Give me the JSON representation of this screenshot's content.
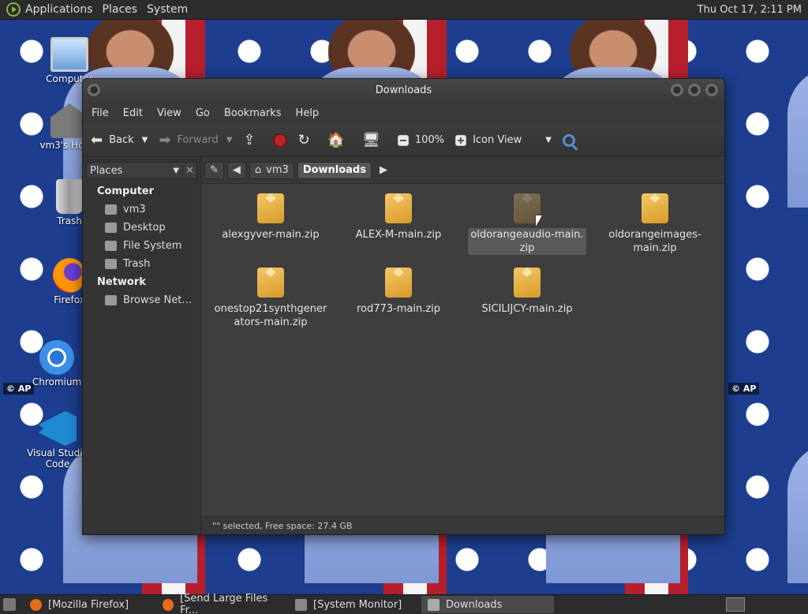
{
  "top_panel": {
    "menus": [
      "Applications",
      "Places",
      "System"
    ],
    "clock": "Thu Oct 17,  2:11 PM"
  },
  "desktop": {
    "icons": [
      {
        "label": "Computer",
        "icon": "computer-icon"
      },
      {
        "label": "vm3's Home",
        "icon": "home-icon"
      },
      {
        "label": "Trash",
        "icon": "trash-icon"
      },
      {
        "label": "Firefox",
        "icon": "firefox-icon"
      },
      {
        "label": "Chromium",
        "icon": "chromium-icon"
      },
      {
        "label": "Visual Studio Code",
        "icon": "vscode-icon"
      }
    ],
    "badge": "© AP"
  },
  "window": {
    "title": "Downloads",
    "menu": [
      "File",
      "Edit",
      "View",
      "Go",
      "Bookmarks",
      "Help"
    ],
    "toolbar": {
      "back": "Back",
      "forward": "Forward",
      "zoom": "100%",
      "view_mode": "Icon View"
    },
    "sidebar": {
      "header": "Places",
      "sections": [
        {
          "title": "Computer",
          "items": [
            "vm3",
            "Desktop",
            "File System",
            "Trash"
          ]
        },
        {
          "title": "Network",
          "items": [
            "Browse Net…"
          ]
        }
      ]
    },
    "pathbar": [
      "vm3",
      "Downloads"
    ],
    "files": [
      {
        "line1": "alexgyver-main.zip",
        "line2": "",
        "selected": false
      },
      {
        "line1": "ALEX-M-main.zip",
        "line2": "",
        "selected": false
      },
      {
        "line1": "oldorangeaudio-main.",
        "line2": "zip",
        "selected": true
      },
      {
        "line1": "oldorangeimages-",
        "line2": "main.zip",
        "selected": false
      },
      {
        "line1": "onestop21synthgener",
        "line2": "ators-main.zip",
        "selected": false
      },
      {
        "line1": "rod773-main.zip",
        "line2": "",
        "selected": false
      },
      {
        "line1": "SICILIJCY-main.zip",
        "line2": "",
        "selected": false
      }
    ],
    "status": "\"\" selected, Free space: 27.4 GB"
  },
  "taskbar": {
    "tasks": [
      {
        "label": "[Mozilla Firefox]",
        "icon": "firefox-icon",
        "active": false
      },
      {
        "label": "[Send Large Files Fr...",
        "icon": "firefox-icon",
        "active": false
      },
      {
        "label": "[System Monitor]",
        "icon": "system-monitor-icon",
        "active": false
      },
      {
        "label": "Downloads",
        "icon": "folder-icon",
        "active": true
      }
    ]
  }
}
